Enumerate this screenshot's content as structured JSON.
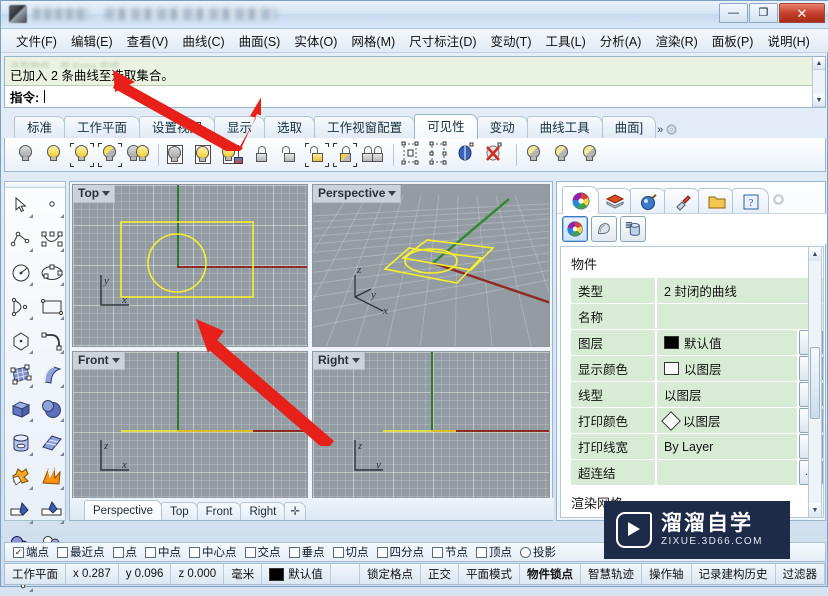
{
  "window": {
    "title_redacted": true,
    "buttons": {
      "minimize": "—",
      "maximize": "❐",
      "close": "✕"
    }
  },
  "menubar": {
    "items": [
      "文件(F)",
      "编辑(E)",
      "查看(V)",
      "曲线(C)",
      "曲面(S)",
      "实体(O)",
      "网格(M)",
      "尺寸标注(D)",
      "变动(T)",
      "工具(L)",
      "分析(A)",
      "渲染(R)",
      "面板(P)",
      "说明(H)"
    ]
  },
  "command": {
    "history_faint": "选取物件，按 Enter 完成",
    "history": "已加入 2 条曲线至选取集合。",
    "prompt_label": "指令:",
    "input_value": ""
  },
  "toolbar_tabs": {
    "items": [
      "标准",
      "工作平面",
      "设置视图",
      "显示",
      "选取",
      "工作视窗配置",
      "可见性",
      "变动",
      "曲线工具",
      "曲面]"
    ],
    "active": "可见性",
    "overflow_label": "»"
  },
  "visibility_toolbar": {
    "icons": [
      "hide-objects-icon",
      "show-objects-icon",
      "show-selected-icon",
      "invert-hidden-icon",
      "swap-hidden-visible-icon",
      "hide-in-detail-icon",
      "show-in-detail-icon",
      "show-selected-detail-icon",
      "lock-objects-icon",
      "unlock-objects-icon",
      "unlock-selected-icon",
      "invert-locked-icon",
      "swap-locked-unlocked-icon",
      "hide-control-points-icon",
      "show-control-points-icon",
      "show-edges-icon",
      "hide-edges-icon",
      "ghost-objects-icon",
      "unghost-objects-icon",
      "select-ghosted-icon"
    ]
  },
  "left_toolbar": {
    "icons": [
      "select-arrow-icon",
      "point-icon",
      "polyline-icon",
      "control-point-curve-icon",
      "circle-icon",
      "ellipse-icon",
      "arc-icon",
      "rectangle-icon",
      "polygon-icon",
      "curve-fillet-icon",
      "surface-from-points-icon",
      "loft-surface-icon",
      "box-icon",
      "sphere-icon",
      "cylinder-icon",
      "planar-surface-icon",
      "boolean-union-icon",
      "explode-icon",
      "trim-icon",
      "split-icon",
      "boolean-difference-icon",
      "boolean-intersection-icon",
      "offset-curve-icon",
      "more-tools-icon"
    ],
    "more_label": "»"
  },
  "viewports": [
    {
      "name": "Top",
      "axes": [
        "y",
        "x"
      ],
      "objects": [
        "rectangle",
        "circle"
      ]
    },
    {
      "name": "Perspective",
      "axes": [
        "z",
        "y",
        "x"
      ],
      "objects": [
        "rectangle",
        "circle"
      ]
    },
    {
      "name": "Front",
      "axes": [
        "z",
        "x"
      ],
      "objects": [
        "edge-line"
      ]
    },
    {
      "name": "Right",
      "axes": [
        "z",
        "y"
      ],
      "objects": [
        "edge-line"
      ]
    }
  ],
  "viewport_tabs": {
    "items": [
      "Perspective",
      "Top",
      "Front",
      "Right"
    ],
    "active": "Perspective",
    "add_label": "✛"
  },
  "properties_panel": {
    "tabs": [
      "properties-tab",
      "layers-tab",
      "render-tab",
      "display-tab",
      "named-views-tab",
      "help-tab"
    ],
    "active_tab": "properties-tab",
    "sub_buttons": [
      "object-properties-icon",
      "material-properties-icon",
      "display-mode-icon"
    ],
    "active_sub": "object-properties-icon",
    "section_title": "物件",
    "rows": [
      {
        "key": "类型",
        "value": "2 封闭的曲线",
        "swatch": null,
        "control": null
      },
      {
        "key": "名称",
        "value": "",
        "swatch": null,
        "control": null
      },
      {
        "key": "图层",
        "value": "默认值",
        "swatch": "black",
        "control": "dropdown"
      },
      {
        "key": "显示颜色",
        "value": "以图层",
        "swatch": "empty",
        "control": "dropdown"
      },
      {
        "key": "线型",
        "value": "以图层",
        "swatch": null,
        "control": "dropdown"
      },
      {
        "key": "打印颜色",
        "value": "以图层",
        "swatch": "diamond",
        "control": "dropdown"
      },
      {
        "key": "打印线宽",
        "value": "By Layer",
        "swatch": null,
        "control": "dropdown"
      },
      {
        "key": "超连结",
        "value": "",
        "swatch": null,
        "control": "ellipsis"
      }
    ],
    "next_section_title": "渲染网格",
    "ellipsis_label": "..."
  },
  "osnap_bar": {
    "items": [
      {
        "label": "端点",
        "type": "checkbox",
        "checked": true
      },
      {
        "label": "最近点",
        "type": "checkbox",
        "checked": false
      },
      {
        "label": "点",
        "type": "checkbox",
        "checked": false
      },
      {
        "label": "中点",
        "type": "checkbox",
        "checked": false
      },
      {
        "label": "中心点",
        "type": "checkbox",
        "checked": false
      },
      {
        "label": "交点",
        "type": "checkbox",
        "checked": false
      },
      {
        "label": "垂点",
        "type": "checkbox",
        "checked": false
      },
      {
        "label": "切点",
        "type": "checkbox",
        "checked": false
      },
      {
        "label": "四分点",
        "type": "checkbox",
        "checked": false
      },
      {
        "label": "节点",
        "type": "checkbox",
        "checked": false
      },
      {
        "label": "顶点",
        "type": "checkbox",
        "checked": false
      },
      {
        "label": "投影",
        "type": "radio",
        "checked": false
      }
    ]
  },
  "status_bar": {
    "cplane": "工作平面",
    "x": "x 0.287",
    "y": "y 0.096",
    "z": "z 0.000",
    "units": "毫米",
    "layer": "默认值",
    "toggles": [
      "锁定格点",
      "正交",
      "平面模式",
      "物件锁点",
      "智慧轨迹",
      "操作轴",
      "记录建构历史",
      "过滤器"
    ]
  },
  "watermark": {
    "title": "溜溜自学",
    "url": "ZIXUE.3D66.COM"
  },
  "annotations": {
    "arrows": [
      {
        "name": "arrow-to-command-message"
      },
      {
        "name": "arrow-to-top-viewport-curves"
      }
    ],
    "color": "#e8201a"
  }
}
